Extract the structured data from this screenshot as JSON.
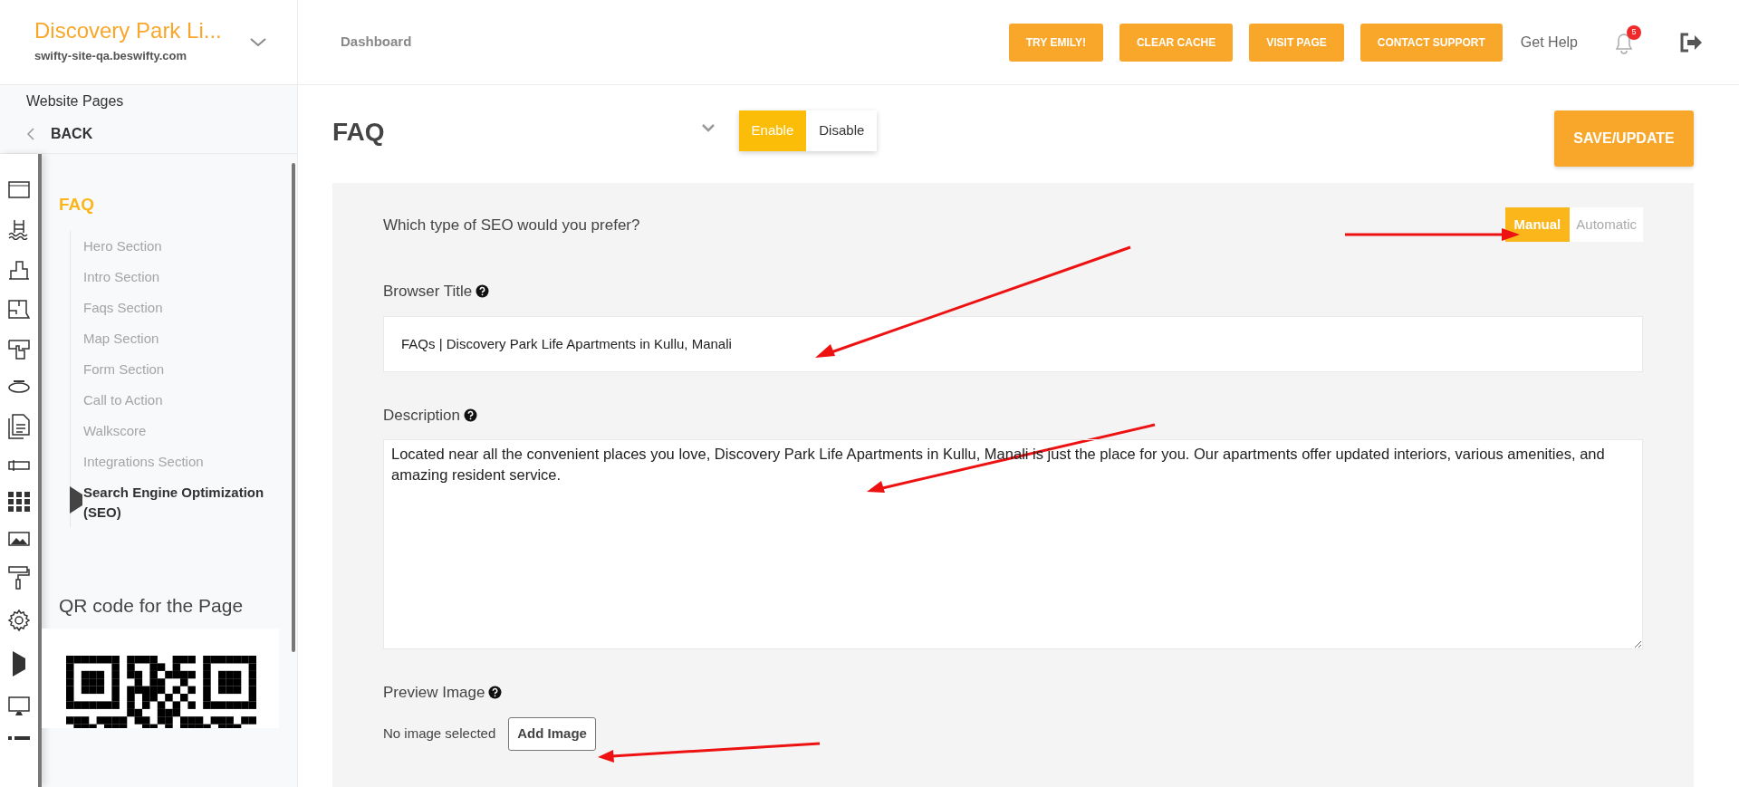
{
  "brand": {
    "title": "Discovery Park Li...",
    "url": "swifty-site-qa.beswifty.com"
  },
  "topbar": {
    "breadcrumb": "Dashboard",
    "buttons": [
      "TRY EMILY!",
      "CLEAR CACHE",
      "VISIT PAGE",
      "CONTACT SUPPORT"
    ],
    "help_link": "Get Help",
    "notification_count": "5"
  },
  "sidebar": {
    "heading": "Website Pages",
    "back": "BACK",
    "page_title": "FAQ",
    "items": [
      {
        "label": "Hero Section",
        "selected": false
      },
      {
        "label": "Intro Section",
        "selected": false
      },
      {
        "label": "Faqs Section",
        "selected": false
      },
      {
        "label": "Map Section",
        "selected": false
      },
      {
        "label": "Form Section",
        "selected": false
      },
      {
        "label": "Call to Action",
        "selected": false
      },
      {
        "label": "Walkscore",
        "selected": false
      },
      {
        "label": "Integrations Section",
        "selected": false
      },
      {
        "label": "Search Engine Optimization (SEO)",
        "selected": true
      }
    ],
    "qr_heading": "QR code for the Page"
  },
  "page": {
    "title": "FAQ",
    "status_toggle": [
      {
        "label": "Enable",
        "selected": true
      },
      {
        "label": "Disable",
        "selected": false
      }
    ],
    "save_button": "SAVE/UPDATE"
  },
  "seo": {
    "question": "Which type of SEO would you prefer?",
    "mode_toggle": [
      {
        "label": "Manual",
        "selected": true
      },
      {
        "label": "Automatic",
        "selected": false
      }
    ],
    "fields": [
      {
        "kind": "input",
        "label": "Browser Title",
        "value": "FAQs | Discovery Park Life Apartments in Kullu, Manali"
      },
      {
        "kind": "textarea",
        "label": "Description",
        "value": "Located near all the convenient places you love, Discovery Park Life Apartments in Kullu, Manali is just the place for you. Our apartments offer updated interiors, various amenities, and amazing resident service."
      }
    ],
    "preview_image": {
      "label": "Preview Image",
      "status": "No image selected",
      "button": "Add Image"
    }
  }
}
